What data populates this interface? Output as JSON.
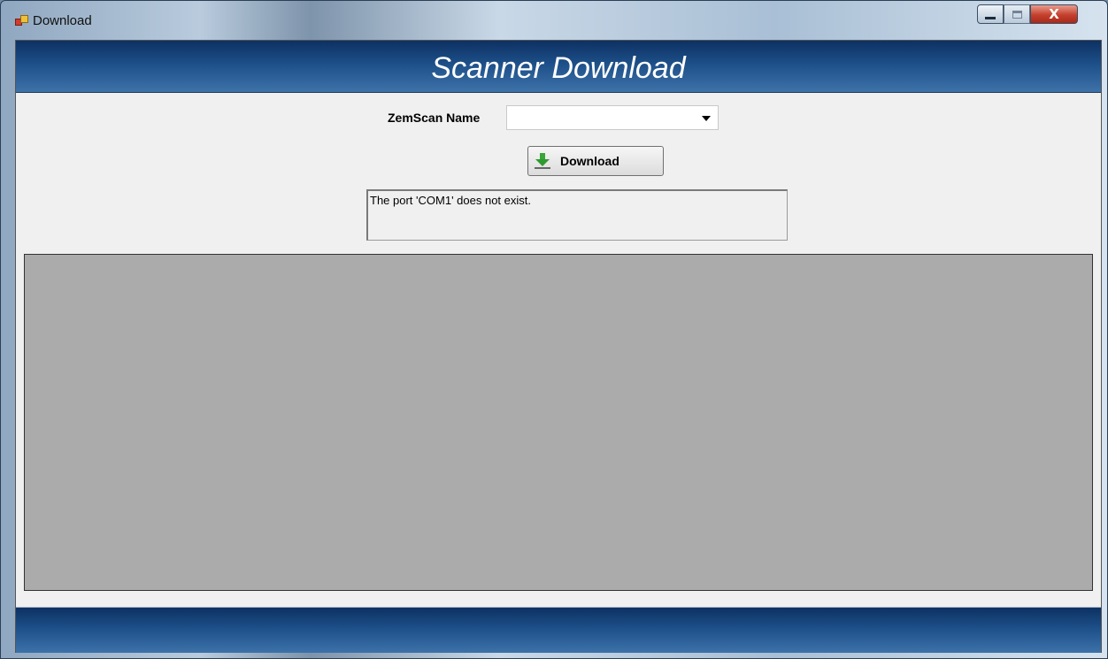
{
  "window": {
    "title": "Download",
    "icon": "app-window-icon",
    "controls": {
      "minimize_icon": "minimize-icon",
      "maximize_icon": "maximize-icon",
      "close_icon": "close-icon",
      "close_glyph": "X"
    }
  },
  "header": {
    "title": "Scanner Download"
  },
  "form": {
    "zemscan_label": "ZemScan Name",
    "zemscan_value": "",
    "download_button_label": "Download",
    "download_icon": "download-arrow-icon"
  },
  "status": {
    "message": "The port 'COM1' does not exist."
  },
  "colors": {
    "header_gradient_top": "#0d3163",
    "header_gradient_bottom": "#3d72a9",
    "panel_gray": "#ababab",
    "client_background": "#f0f0f0",
    "close_button": "#c4402c"
  }
}
